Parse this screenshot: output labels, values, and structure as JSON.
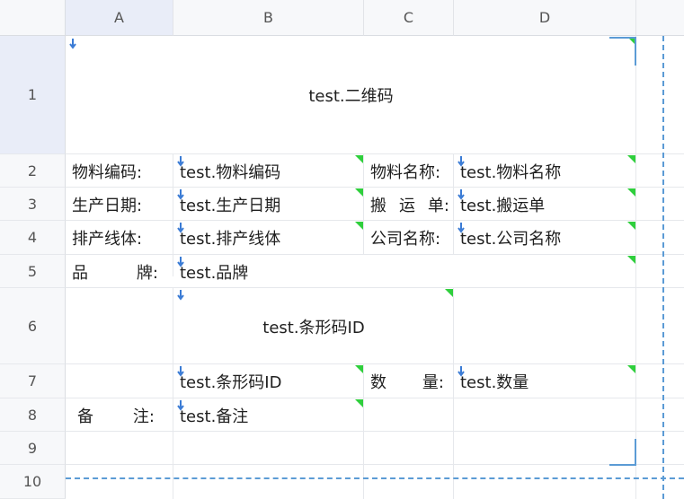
{
  "columns": [
    "A",
    "B",
    "C",
    "D"
  ],
  "rows": [
    "1",
    "2",
    "3",
    "4",
    "5",
    "6",
    "7",
    "8",
    "9",
    "10"
  ],
  "cells": {
    "title": "test.二维码",
    "r2": {
      "label_a": "物料编码:",
      "value_b": "test.物料编码",
      "label_c": "物料名称:",
      "value_d": "test.物料名称"
    },
    "r3": {
      "label_a": "生产日期:",
      "value_b": "test.生产日期",
      "label_c_chars": [
        "搬",
        "运",
        "单:"
      ],
      "value_d": "test.搬运单"
    },
    "r4": {
      "label_a": "排产线体:",
      "value_b": "test.排产线体",
      "label_c": "公司名称:",
      "value_d": "test.公司名称"
    },
    "r5": {
      "label_a_chars": [
        "品",
        "牌:"
      ],
      "value_b": "test.品牌"
    },
    "r6": {
      "value_b": "test.条形码ID"
    },
    "r7": {
      "value_b": "test.条形码ID",
      "label_c_chars": [
        "数",
        "量:"
      ],
      "value_d": "test.数量"
    },
    "r8": {
      "label_a_chars": [
        "备",
        "注:"
      ],
      "value_b": "test.备注"
    }
  },
  "colors": {
    "flag": "#2fcf3c",
    "arrow": "#3a7bd5",
    "page_break": "#5b9bd5"
  }
}
